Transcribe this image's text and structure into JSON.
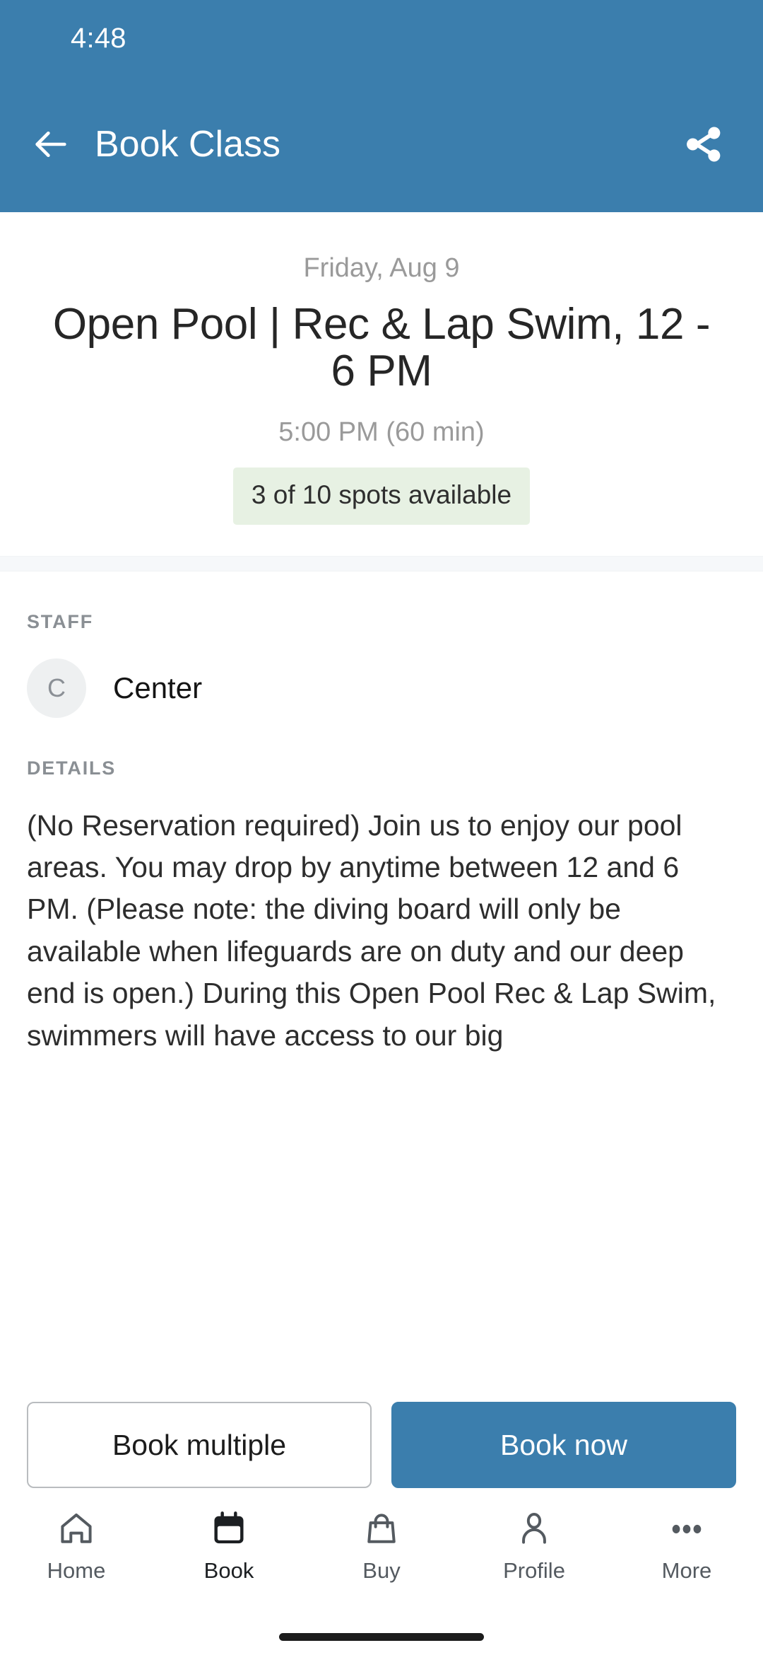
{
  "status_bar": {
    "time": "4:48"
  },
  "app_bar": {
    "title": "Book Class",
    "back_icon": "arrow-left-icon",
    "share_icon": "share-icon",
    "background_color": "#3b7ead"
  },
  "hero": {
    "date": "Friday, Aug 9",
    "title": "Open Pool | Rec & Lap Swim, 12 - 6 PM",
    "time": "5:00 PM (60 min)",
    "availability": "3 of 10 spots available",
    "availability_bg_color": "#e7f1e3"
  },
  "staff": {
    "label": "STAFF",
    "avatar_initial": "C",
    "name": "Center"
  },
  "details": {
    "label": "DETAILS",
    "text": "(No Reservation required)   Join us to enjoy our pool areas. You may drop by anytime between 12 and 6 PM.  (Please note: the diving board will only be available when lifeguards are on duty and our deep end is open.) During this Open Pool Rec & Lap Swim, swimmers will have access to our big"
  },
  "actions": {
    "secondary_label": "Book multiple",
    "primary_label": "Book now",
    "primary_color": "#3b7ead"
  },
  "bottom_nav": {
    "items": [
      {
        "label": "Home",
        "icon": "home-icon",
        "active": false
      },
      {
        "label": "Book",
        "icon": "calendar-icon",
        "active": true
      },
      {
        "label": "Buy",
        "icon": "shopping-bag-icon",
        "active": false
      },
      {
        "label": "Profile",
        "icon": "person-icon",
        "active": false
      },
      {
        "label": "More",
        "icon": "more-horizontal-icon",
        "active": false
      }
    ]
  }
}
